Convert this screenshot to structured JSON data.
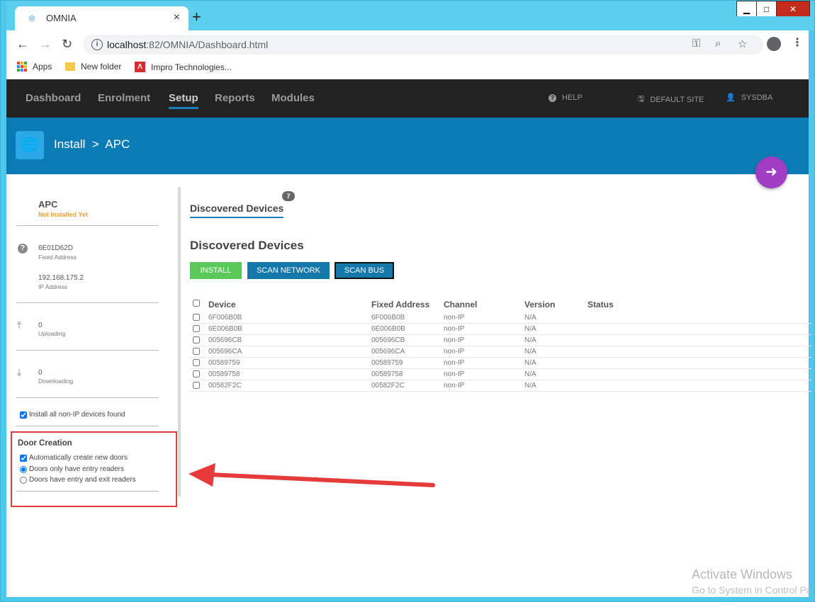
{
  "browser": {
    "tab_title": "OMNIA",
    "tab_close": "×",
    "new_tab": "+",
    "url_host": "localhost",
    "url_path": ":82/OMNIA/Dashboard.html",
    "bookmarks": [
      "Apps",
      "New folder",
      "Impro Technologies..."
    ]
  },
  "nav": {
    "items": [
      "Dashboard",
      "Enrolment",
      "Setup",
      "Reports",
      "Modules"
    ],
    "active": "Setup",
    "help": "HELP",
    "site": "DEFAULT SITE",
    "user": "SYSDBA"
  },
  "banner": {
    "crumb": "Install  >  APC"
  },
  "sidebar": {
    "title": "APC",
    "status": "Not Installed Yet",
    "address_value": "6E01D62D",
    "address_label": "Fixed Address",
    "ip_value": "192.168.175.2",
    "ip_label": "IP Address",
    "uploading_value": "0",
    "uploading_label": "Uploading",
    "downloading_value": "0",
    "downloading_label": "Downloading",
    "install_nonip": "Install all non-IP devices found",
    "door_title": "Door Creation",
    "door_auto": "Automatically create new doors",
    "door_entry": "Doors only have entry readers",
    "door_entry_exit": "Doors have entry and exit readers"
  },
  "content": {
    "tab_label": "Discovered Devices",
    "tab_count": "7",
    "section_title": "Discovered Devices",
    "buttons": {
      "install": "INSTALL",
      "scan_network": "SCAN NETWORK",
      "scan_bus": "SCAN BUS"
    },
    "columns": [
      "Device",
      "Fixed Address",
      "Channel",
      "Version",
      "Status"
    ],
    "rows": [
      [
        "6F006B0B",
        "6F006B0B",
        "non-IP",
        "N/A",
        ""
      ],
      [
        "6E006B0B",
        "6E006B0B",
        "non-IP",
        "N/A",
        ""
      ],
      [
        "005696CB",
        "005696CB",
        "non-IP",
        "N/A",
        ""
      ],
      [
        "005696CA",
        "005696CA",
        "non-IP",
        "N/A",
        ""
      ],
      [
        "00589759",
        "00589759",
        "non-IP",
        "N/A",
        ""
      ],
      [
        "00589758",
        "00589758",
        "non-IP",
        "N/A",
        ""
      ],
      [
        "00582F2C",
        "00582F2C",
        "non-IP",
        "N/A",
        ""
      ]
    ]
  },
  "watermark": {
    "line1": "Activate Windows",
    "line2": "Go to System in Control Panel to activate Windows."
  },
  "colors": {
    "navbar": "#222222",
    "banner": "#0b7bb5",
    "install_button": "#5ac95a",
    "scan_button": "#1478ab",
    "back_button": "#a03dc4",
    "annotation": "#e53b3b"
  }
}
